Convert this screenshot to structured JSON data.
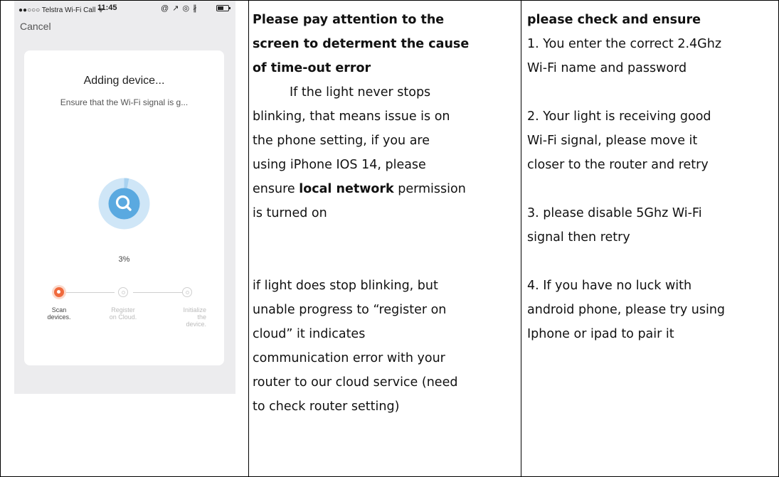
{
  "phone": {
    "status_carrier": "●●○○○ Telstra Wi-Fi Call ᯤ",
    "status_time": "11:45",
    "status_right": "@ ↗ ◎ ∦",
    "cancel_label": "Cancel",
    "title": "Adding device...",
    "subtitle": "Ensure that the Wi-Fi signal is g...",
    "progress_percent": 3,
    "progress_text": "3%",
    "steps": [
      {
        "label_line1": "Scan",
        "label_line2": "devices.",
        "label_line3": "",
        "state": "active"
      },
      {
        "label_line1": "Register",
        "label_line2": "on Cloud.",
        "label_line3": "",
        "state": "idle"
      },
      {
        "label_line1": "Initialize",
        "label_line2": "the",
        "label_line3": "device.",
        "state": "idle"
      }
    ],
    "colors": {
      "accent": "#f06a3d",
      "ring_dark": "#5aa9e0",
      "ring_light": "#cfe6f7",
      "background": "#ececee"
    }
  },
  "middle": {
    "heading_lines": [
      "Please pay attention to the",
      "screen to determent the cause",
      "of time-out error"
    ],
    "para1_lines": [
      "If the light never stops",
      "blinking, that means issue is on",
      "the phone setting, if you are",
      "using iPhone IOS 14, please"
    ],
    "para1_pre_bold": "ensure ",
    "para1_bold": "local network",
    "para1_post_bold": " permission",
    "para1_last": "is turned on",
    "para2_lines": [
      "if light does stop blinking, but",
      "unable progress to “register on",
      "cloud”   it indicates",
      "communication error with your",
      "router to our cloud service (need",
      "to check router setting)"
    ]
  },
  "right": {
    "heading": "please check and ensure",
    "item1_lines": [
      "1. You enter the correct 2.4Ghz",
      "Wi-Fi name and password"
    ],
    "item2_lines": [
      "2. Your light is receiving good",
      "Wi-Fi signal, please move it",
      "closer to the router and retry"
    ],
    "item3_lines": [
      "3. please disable 5Ghz Wi-Fi",
      "signal then retry"
    ],
    "item4_lines": [
      "4. If you have no luck with",
      "android phone, please try using",
      "Iphone or ipad to pair it"
    ]
  }
}
